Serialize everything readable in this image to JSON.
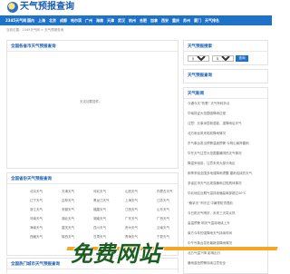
{
  "header": {
    "logo_text": "天气预报查询"
  },
  "nav": [
    "2345天气网",
    "国内",
    "上海",
    "北京",
    "成都",
    "哈尔滨",
    "广州",
    "海南",
    "天津",
    "武汉",
    "杭州",
    "合肥",
    "加拿",
    "西安",
    "重庆",
    "苏州",
    "厦门",
    "天气排名"
  ],
  "breadcrumb": "当前位置：2345天气网 > 天气预报查询",
  "main": {
    "title": "全国各省市天气预报查询",
    "empty_text": "无法加载插件。"
  },
  "query": {
    "title": "天气预报搜索",
    "province": "请选",
    "city": "城市",
    "button": "查询"
  },
  "weather_query": {
    "title": "天气预报查询"
  },
  "news": {
    "title": "天气新闻",
    "items": [
      "今通今天\"热晕\"  天气有转折点",
      "华南将迎大范围强降雨过程",
      "注意！长事深层新湿能，重降雨后天气",
      "北方雨台风来临前降雨情况",
      "东气象台发出预警温度预警 今明山南阵雷雨",
      "华东天气注意大范围雷暴阴热天气情况",
      "降温来临前，注意未来大部分地区",
      "雨季来临全国多地强降雨提醒 雷雨连续的天气",
      "多省区市天气出现强暴雨过程具体情况",
      "华北地区近期气温持续偏高局部超过40℃",
      "\"桑拿天\"不好过 中暑预防须提前",
      "今日阳光气晴好，未来三天将炎热",
      "高温预警 明天气温将继续上升",
      "南方今年的强降雨天气持续时间",
      "中午气象台发布最新强降雨情况",
      "北方气温下降 影响出行",
      "暴雨蓝色预警持续注意安全",
      "江南等地有大到暴雨局地特大暴雨"
    ]
  },
  "provinces": {
    "title": "全国省份天气预报查询",
    "items": [
      "北京天气",
      "天津天气",
      "河北天气",
      "山西天气",
      "内蒙古天气",
      "辽宁天气",
      "吉林天气",
      "黑龙江天气",
      "上海天气",
      "江苏天气",
      "浙江天气",
      "安徽天气",
      "福建天气",
      "江西天气",
      "山东天气",
      "河南天气",
      "湖北天气",
      "湖南天气",
      "广东天气",
      "广西天气",
      "海南天气",
      "重庆天气",
      "四川天气",
      "贵州天气",
      "云南天气",
      "西藏天气",
      "陕西天气",
      "甘肃天气",
      "青海天气",
      "宁夏天气"
    ]
  },
  "hot_cities": {
    "title": "全国热门城市天气预报查询"
  },
  "watermark": "免费网站",
  "colors": {
    "nav_bg": "#1e73c8",
    "title": "#1a5fb4",
    "watermark": "#1b5e20",
    "accent": "#f5a623"
  }
}
